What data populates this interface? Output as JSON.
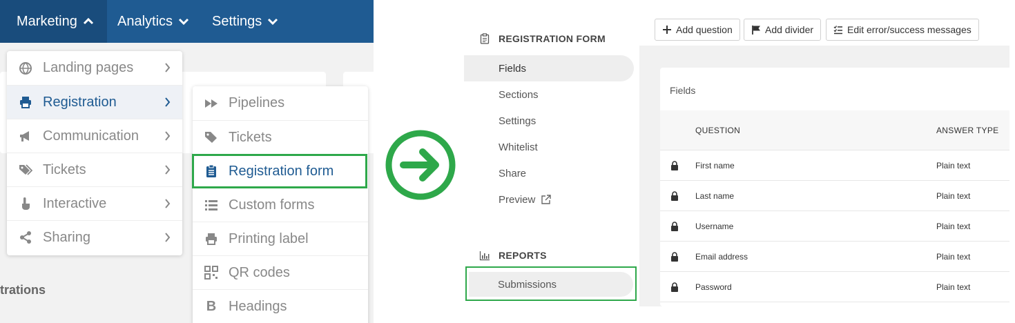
{
  "left_panel": {
    "topnav": [
      {
        "label": "Marketing",
        "expanded": true
      },
      {
        "label": "Analytics",
        "expanded": false
      },
      {
        "label": "Settings",
        "expanded": false
      }
    ],
    "background_heading": "trations",
    "marketing_menu": [
      {
        "label": "Landing pages",
        "icon": "globe-icon"
      },
      {
        "label": "Registration",
        "icon": "printer-icon",
        "selected": true
      },
      {
        "label": "Communication",
        "icon": "megaphone-icon"
      },
      {
        "label": "Tickets",
        "icon": "tags-icon"
      },
      {
        "label": "Interactive",
        "icon": "pointer-hand-icon"
      },
      {
        "label": "Sharing",
        "icon": "share-icon"
      }
    ],
    "registration_submenu": [
      {
        "label": "Pipelines",
        "icon": "fast-forward-icon"
      },
      {
        "label": "Tickets",
        "icon": "tag-icon"
      },
      {
        "label": "Registration form",
        "icon": "clipboard-icon",
        "highlighted": true
      },
      {
        "label": "Custom forms",
        "icon": "list-icon"
      },
      {
        "label": "Printing label",
        "icon": "printer-icon"
      },
      {
        "label": "QR codes",
        "icon": "qr-code-icon"
      },
      {
        "label": "Headings",
        "icon": "bold-icon"
      }
    ]
  },
  "arrow": {
    "icon": "arrow-right-circle-icon"
  },
  "right_panel": {
    "sidebar": {
      "registration_form": {
        "title": "REGISTRATION FORM",
        "icon": "clipboard-icon",
        "items": [
          {
            "label": "Fields",
            "active": true
          },
          {
            "label": "Sections"
          },
          {
            "label": "Settings"
          },
          {
            "label": "Whitelist"
          },
          {
            "label": "Share"
          },
          {
            "label": "Preview",
            "icon": "external-link-icon"
          }
        ]
      },
      "reports": {
        "title": "REPORTS",
        "icon": "bar-chart-icon",
        "items": [
          {
            "label": "Submissions",
            "highlighted": true
          }
        ]
      }
    },
    "toolbar": [
      {
        "label": "Add question",
        "icon": "plus-icon"
      },
      {
        "label": "Add divider",
        "icon": "flag-icon"
      },
      {
        "label": "Edit error/success messages",
        "icon": "checklist-icon"
      }
    ],
    "fields_card": {
      "title": "Fields",
      "columns": [
        "QUESTION",
        "ANSWER TYPE"
      ],
      "rows": [
        {
          "question": "First name",
          "answer_type": "Plain text"
        },
        {
          "question": "Last name",
          "answer_type": "Plain text"
        },
        {
          "question": "Username",
          "answer_type": "Plain text"
        },
        {
          "question": "Email address",
          "answer_type": "Plain text"
        },
        {
          "question": "Password",
          "answer_type": "Plain text"
        }
      ]
    }
  },
  "colors": {
    "nav_blue": "#1f5b92",
    "highlight_green": "#2ea84a"
  }
}
